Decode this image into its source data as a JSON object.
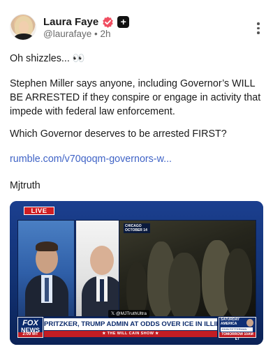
{
  "post": {
    "display_name": "Laura Faye",
    "handle": "@laurafaye",
    "separator": "•",
    "time_ago": "2h",
    "paragraphs": [
      "Oh shizzles... 👀",
      "Stephen Miller says anyone, including Governor’s WILL BE ARRESTED if they conspire or engage in activity that impede with federal law enforcement.",
      "Which Governor deserves to be arrested FIRST?"
    ],
    "link_text": "rumble.com/v70qoqm-governors-w...",
    "tag_line": "Mjtruth"
  },
  "icons": {
    "verified": "verified-badge-icon",
    "plus": "plus-badge-icon",
    "more": "more-options-icon"
  },
  "media": {
    "live_label": "LIVE",
    "location_tag": "CHICAGO OCTOBER 14",
    "watermark": "@MJTruthUltra",
    "network_label_top": "FOX",
    "network_label_bottom": "NEWS",
    "clock": "2:09 MT",
    "headline": "PRITZKER, TRUMP ADMIN AT ODDS OVER ICE IN ILLINOIS",
    "show_bar": "★ THE WILL CAIN SHOW ★",
    "promo": {
      "line1": "SATURDAY",
      "line2": "AMERICA",
      "guest": "JOHN FETTERMAN",
      "when": "TOMORROW 10AM ET"
    }
  },
  "colors": {
    "link": "#3f63c6",
    "verified_badge": "#f04e61",
    "fox_blue": "#0b2a6b",
    "fox_red": "#c21d24"
  }
}
